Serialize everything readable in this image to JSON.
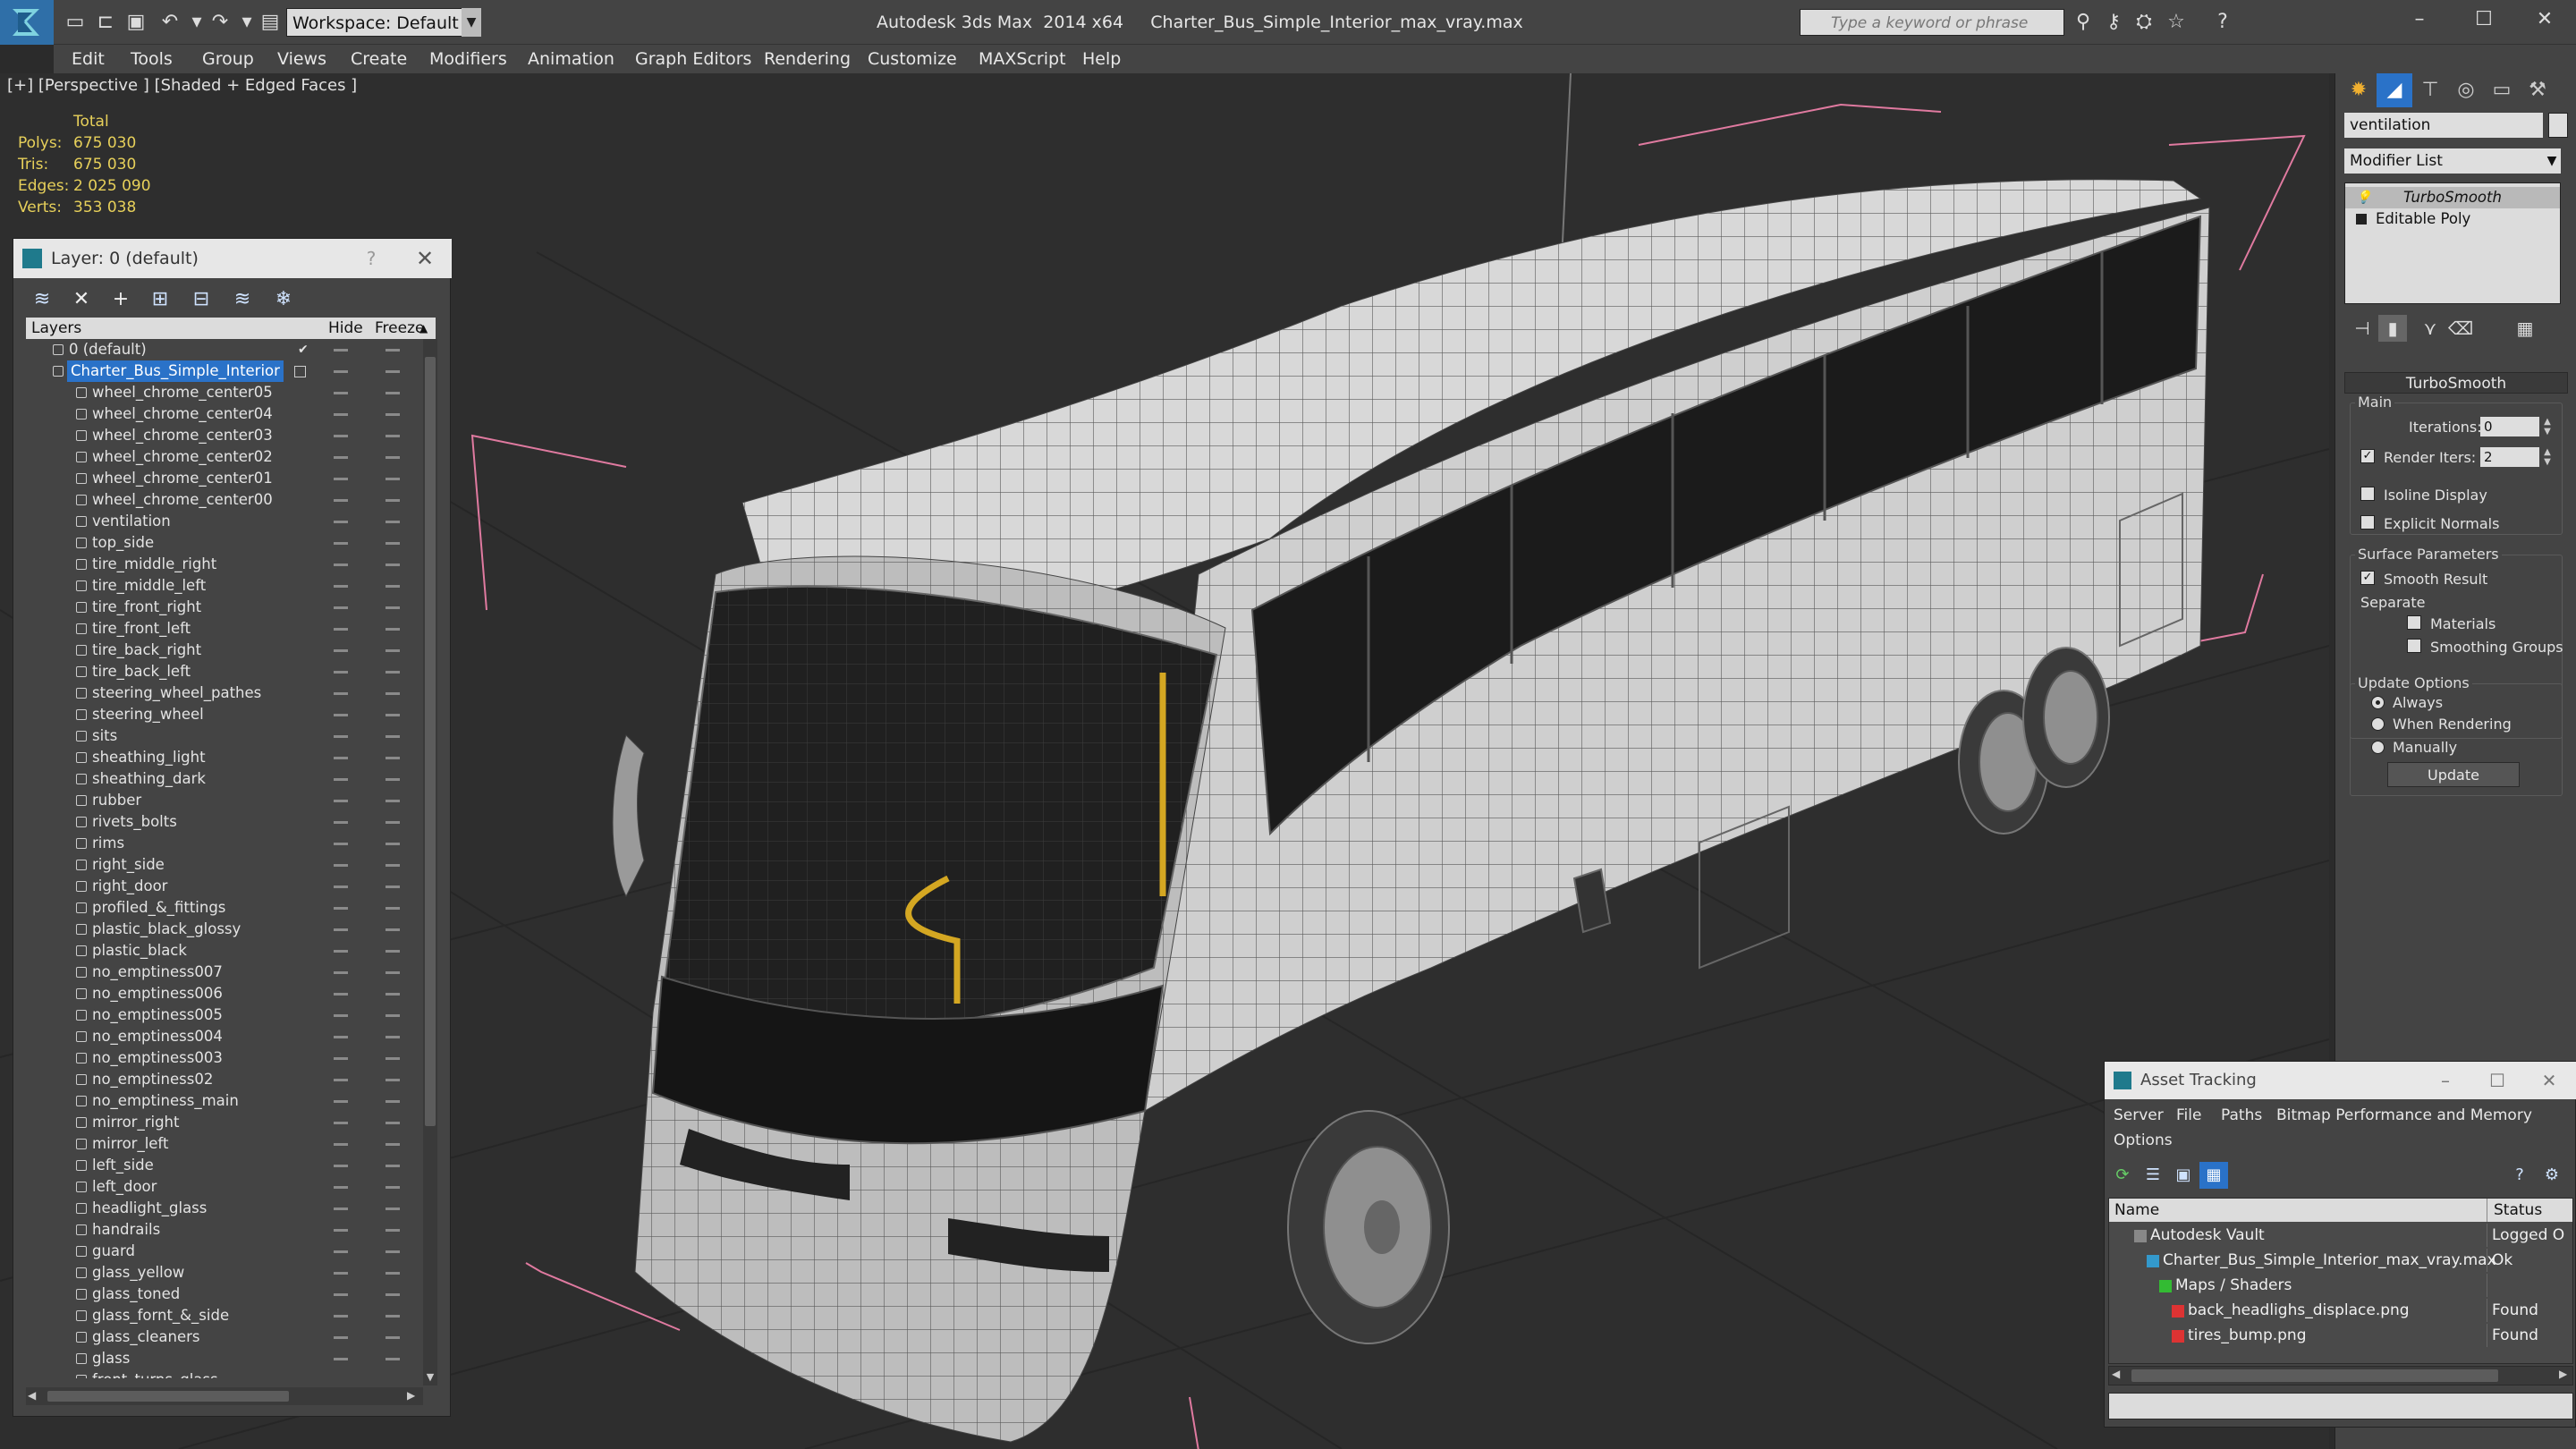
{
  "titlebar": {
    "workspace": "Workspace: Default",
    "app": "Autodesk 3ds Max  2014 x64",
    "file": "Charter_Bus_Simple_Interior_max_vray.max",
    "search_placeholder": "Type a keyword or phrase"
  },
  "menu": [
    "Edit",
    "Tools",
    "Group",
    "Views",
    "Create",
    "Modifiers",
    "Animation",
    "Graph Editors",
    "Rendering",
    "Customize",
    "MAXScript",
    "Help"
  ],
  "viewport": {
    "label": "[+] [Perspective ] [Shaded + Edged Faces ]",
    "stats": {
      "header": "Total",
      "rows": [
        {
          "k": "Polys:",
          "v": "675 030"
        },
        {
          "k": "Tris:",
          "v": "675 030"
        },
        {
          "k": "Edges:",
          "v": "2 025 090"
        },
        {
          "k": "Verts:",
          "v": "353 038"
        }
      ]
    }
  },
  "layer_panel": {
    "title": "Layer: 0 (default)",
    "help": "?",
    "col_layers": "Layers",
    "col_hide": "Hide",
    "col_freeze": "Freeze",
    "default_layer": "0 (default)",
    "selected_layer": "Charter_Bus_Simple_Interior",
    "objects": [
      "wheel_chrome_center05",
      "wheel_chrome_center04",
      "wheel_chrome_center03",
      "wheel_chrome_center02",
      "wheel_chrome_center01",
      "wheel_chrome_center00",
      "ventilation",
      "top_side",
      "tire_middle_right",
      "tire_middle_left",
      "tire_front_right",
      "tire_front_left",
      "tire_back_right",
      "tire_back_left",
      "steering_wheel_pathes",
      "steering_wheel",
      "sits",
      "sheathing_light",
      "sheathing_dark",
      "rubber",
      "rivets_bolts",
      "rims",
      "right_side",
      "right_door",
      "profiled_&_fittings",
      "plastic_black_glossy",
      "plastic_black",
      "no_emptiness007",
      "no_emptiness006",
      "no_emptiness005",
      "no_emptiness004",
      "no_emptiness003",
      "no_emptiness02",
      "no_emptiness_main",
      "mirror_right",
      "mirror_left",
      "left_side",
      "left_door",
      "headlight_glass",
      "handrails",
      "guard",
      "glass_yellow",
      "glass_toned",
      "glass_fornt_&_side",
      "glass_cleaners",
      "glass",
      "front_turns_glass"
    ]
  },
  "command_panel": {
    "object_name": "ventilation",
    "modifier_list": "Modifier List",
    "stack": [
      "TurboSmooth",
      "Editable Poly"
    ],
    "rollout": "TurboSmooth",
    "main_group": "Main",
    "iterations_label": "Iterations:",
    "iterations": "0",
    "render_iters_label": "Render Iters:",
    "render_iters": "2",
    "isoline": "Isoline Display",
    "explicit_normals": "Explicit Normals",
    "surface_group": "Surface Parameters",
    "smooth_result": "Smooth Result",
    "separate": "Separate",
    "materials": "Materials",
    "smoothing_groups": "Smoothing Groups",
    "update_group": "Update Options",
    "always": "Always",
    "when_rendering": "When Rendering",
    "manually": "Manually",
    "update": "Update"
  },
  "asset_tracking": {
    "title": "Asset Tracking",
    "menu": [
      "Server",
      "File",
      "Paths",
      "Bitmap Performance and Memory",
      "Options"
    ],
    "col_name": "Name",
    "col_status": "Status",
    "rows": [
      {
        "name": "Autodesk Vault",
        "status": "Logged O",
        "indent": 1
      },
      {
        "name": "Charter_Bus_Simple_Interior_max_vray.max",
        "status": "Ok",
        "indent": 2
      },
      {
        "name": "Maps / Shaders",
        "status": "",
        "indent": 3
      },
      {
        "name": "back_headlighs_displace.png",
        "status": "Found",
        "indent": 4
      },
      {
        "name": "tires_bump.png",
        "status": "Found",
        "indent": 4
      }
    ]
  }
}
